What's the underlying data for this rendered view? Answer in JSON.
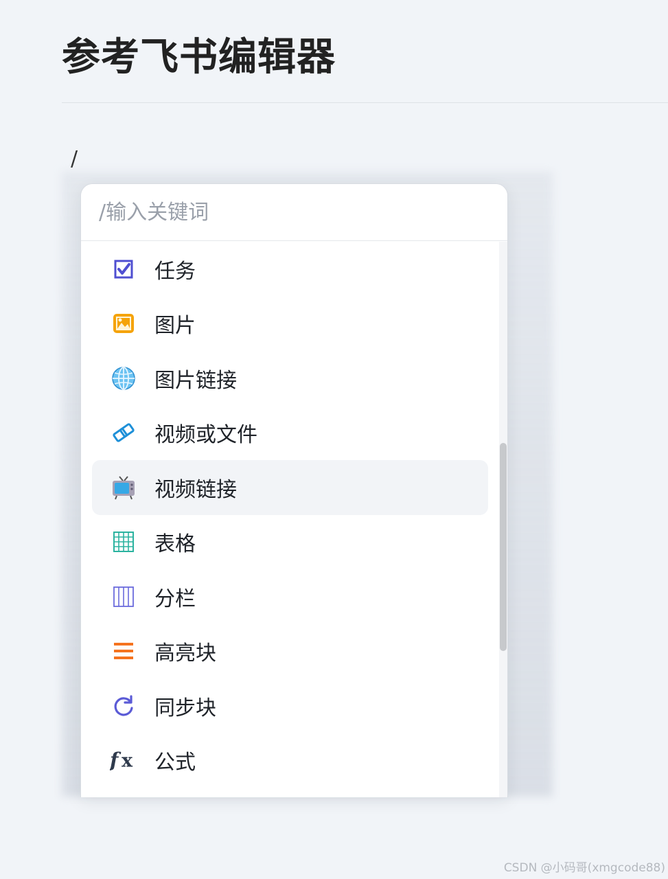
{
  "page": {
    "title": "参考飞书编辑器",
    "slash_text": "/"
  },
  "menu": {
    "search_placeholder": "/输入关键词",
    "items": [
      {
        "label": "任务",
        "icon": "checkbox-icon"
      },
      {
        "label": "图片",
        "icon": "image-icon"
      },
      {
        "label": "图片链接",
        "icon": "globe-icon"
      },
      {
        "label": "视频或文件",
        "icon": "link-icon"
      },
      {
        "label": "视频链接",
        "icon": "tv-icon",
        "active": true
      },
      {
        "label": "表格",
        "icon": "table-icon"
      },
      {
        "label": "分栏",
        "icon": "columns-icon"
      },
      {
        "label": "高亮块",
        "icon": "highlight-block-icon"
      },
      {
        "label": "同步块",
        "icon": "sync-icon"
      },
      {
        "label": "公式",
        "icon": "formula-icon"
      }
    ]
  },
  "colors": {
    "accent_purple": "#5b5bd6",
    "image_orange": "#f5a30a",
    "highlight_orange": "#f5731f",
    "table_teal": "#2bb3a0"
  },
  "watermark": "CSDN @小码哥(xmgcode88)"
}
